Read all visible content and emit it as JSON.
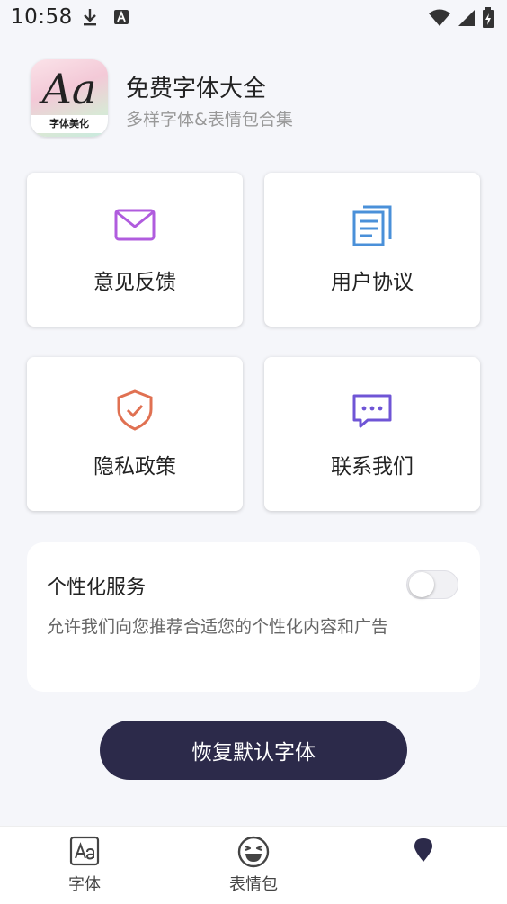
{
  "status_bar": {
    "time": "10:58",
    "icons": [
      "download-icon",
      "a-badge-icon",
      "wifi-icon",
      "signal-icon",
      "battery-icon"
    ]
  },
  "app": {
    "logo_text": "Aa",
    "logo_subtext": "字体美化",
    "title": "免费字体大全",
    "subtitle": "多样字体&表情包合集"
  },
  "cards": [
    {
      "label": "意见反馈",
      "icon": "mail-icon",
      "color": "#b05cde"
    },
    {
      "label": "用户协议",
      "icon": "document-icon",
      "color": "#4a90d9"
    },
    {
      "label": "隐私政策",
      "icon": "shield-icon",
      "color": "#e07152"
    },
    {
      "label": "联系我们",
      "icon": "chat-icon",
      "color": "#6f55d6"
    }
  ],
  "personalized": {
    "title": "个性化服务",
    "description": "允许我们向您推荐合适您的个性化内容和广告",
    "enabled": false
  },
  "reset_button": {
    "label": "恢复默认字体"
  },
  "bottom_nav": [
    {
      "label": "字体",
      "icon": "font-aa-icon"
    },
    {
      "label": "表情包",
      "icon": "laughing-emoji-icon"
    },
    {
      "label": "",
      "icon": "location-pin-icon"
    }
  ],
  "colors": {
    "primary_button": "#2c2a4a",
    "background": "#f5f6fa"
  }
}
